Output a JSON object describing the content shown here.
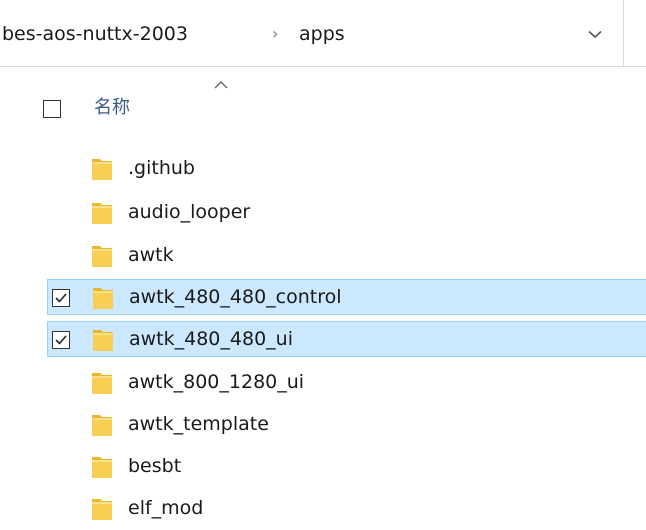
{
  "address_bar": {
    "crumbs": [
      "bes-aos-nuttx-2003",
      "apps"
    ],
    "separator": "›",
    "dropdown_icon": "chevron-down-icon"
  },
  "header": {
    "sort_icon": "sort-ascending-icon",
    "name_column": "名称"
  },
  "files": [
    {
      "name": ".github",
      "selected": false,
      "type": "folder"
    },
    {
      "name": "audio_looper",
      "selected": false,
      "type": "folder"
    },
    {
      "name": "awtk",
      "selected": false,
      "type": "folder"
    },
    {
      "name": "awtk_480_480_control",
      "selected": true,
      "type": "folder"
    },
    {
      "name": "awtk_480_480_ui",
      "selected": true,
      "type": "folder"
    },
    {
      "name": "awtk_800_1280_ui",
      "selected": false,
      "type": "folder"
    },
    {
      "name": "awtk_template",
      "selected": false,
      "type": "folder"
    },
    {
      "name": "besbt",
      "selected": false,
      "type": "folder"
    },
    {
      "name": "elf_mod",
      "selected": false,
      "type": "folder"
    }
  ],
  "colors": {
    "selection_bg": "#cce8ff",
    "selection_border": "#99d1ff",
    "folder_yellow": "#f5c542"
  }
}
